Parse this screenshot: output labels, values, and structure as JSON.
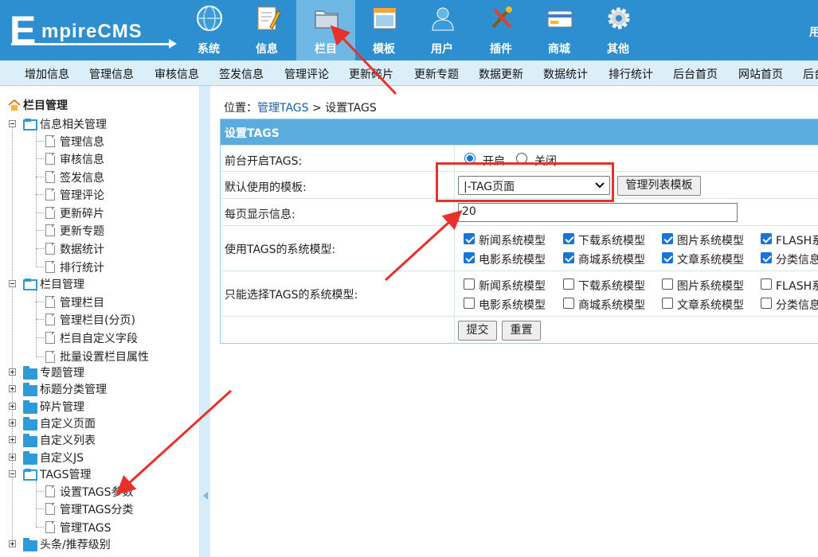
{
  "logo": {
    "letter": "E",
    "text": "mpireCMS"
  },
  "main_nav": [
    {
      "label": "系统",
      "icon": "globe-icon"
    },
    {
      "label": "信息",
      "icon": "edit-document-icon"
    },
    {
      "label": "栏目",
      "icon": "folder-icon",
      "active": true
    },
    {
      "label": "模板",
      "icon": "window-template-icon"
    },
    {
      "label": "用户",
      "icon": "user-icon"
    },
    {
      "label": "插件",
      "icon": "tools-icon"
    },
    {
      "label": "商城",
      "icon": "card-icon"
    },
    {
      "label": "其他",
      "icon": "gear-icon"
    }
  ],
  "header_right": "用",
  "sub_nav": [
    "增加信息",
    "管理信息",
    "审核信息",
    "签发信息",
    "管理评论",
    "更新碎片",
    "更新专题",
    "数据更新",
    "数据统计",
    "排行统计",
    "后台首页",
    "网站首页",
    "后台"
  ],
  "sidebar": {
    "root": "栏目管理",
    "groups": [
      {
        "label": "信息相关管理",
        "children": [
          "管理信息",
          "审核信息",
          "签发信息",
          "管理评论",
          "更新碎片",
          "更新专题",
          "数据统计",
          "排行统计"
        ]
      },
      {
        "label": "栏目管理",
        "children": [
          "管理栏目",
          "管理栏目(分页)",
          "栏目自定义字段",
          "批量设置栏目属性"
        ]
      },
      {
        "label": "专题管理"
      },
      {
        "label": "标题分类管理"
      },
      {
        "label": "碎片管理"
      },
      {
        "label": "自定义页面"
      },
      {
        "label": "自定义列表"
      },
      {
        "label": "自定义JS"
      },
      {
        "label": "TAGS管理",
        "children": [
          "设置TAGS参数",
          "管理TAGS分类",
          "管理TAGS"
        ]
      },
      {
        "label": "头条/推荐级别"
      }
    ]
  },
  "breadcrumb": {
    "prefix": "位置：",
    "link": "管理TAGS",
    "sep": " > ",
    "current": "设置TAGS"
  },
  "form": {
    "title": "设置TAGS",
    "enable_label": "前台开启TAGS:",
    "enable_on": "开启",
    "enable_off": "关闭",
    "template_label": "默认使用的模板:",
    "template_value": "|-TAG页面",
    "template_button": "管理列表模板",
    "perpage_label": "每页显示信息:",
    "perpage_value": "20",
    "models_label": "使用TAGS的系统模型:",
    "only_label": "只能选择TAGS的系统模型:",
    "models_row1": [
      "新闻系统模型",
      "下载系统模型",
      "图片系统模型",
      "FLASH系"
    ],
    "models_row2": [
      "电影系统模型",
      "商城系统模型",
      "文章系统模型",
      "分类信息"
    ],
    "submit": "提交",
    "reset": "重置"
  },
  "colors": {
    "header": "#2E8FD0",
    "active_tab": "#6FB8E6",
    "annotation": "#E8312A"
  }
}
